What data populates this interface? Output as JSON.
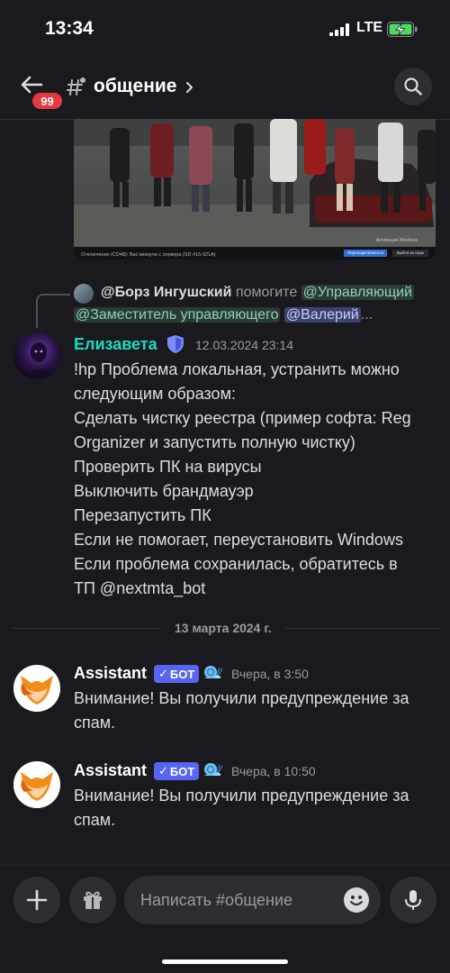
{
  "status": {
    "time": "13:34",
    "network": "LTE"
  },
  "header": {
    "badge": "99",
    "channel": "общение"
  },
  "attachment": {
    "caption": "Отключение (CD48): Вас кикнули с сервера (SD #16-021A)",
    "button_primary": "Переподключиться",
    "button_secondary": "Выйти из игры",
    "sign": "Активация Windows"
  },
  "reply": {
    "author": "@Борз Ингушский",
    "text": "помогите",
    "mention1": "@Управляющий",
    "mention2": "@Заместитель управляющего",
    "mention3": "@Валерий",
    "ellipsis": "..."
  },
  "message1": {
    "author": "Елизавета",
    "timestamp": "12.03.2024 23:14",
    "lines": [
      "!hp Проблема локальная, устранить можно",
      "следующим образом:",
      "Сделать чистку реестра (пример софта: Reg",
      "Organizer и запустить полную чистку)",
      "Проверить ПК на вирусы",
      "Выключить брандмауэр",
      "Перезапустить ПК",
      "Если не помогает, переустановить Windows",
      "Если проблема сохранилась, обратитесь в",
      "ТП @nextmta_bot"
    ]
  },
  "date_divider": "13 марта 2024 г.",
  "message2": {
    "author": "Assistant",
    "bot_tag": "БОТ",
    "timestamp": "Вчера, в 3:50",
    "lines": [
      "Внимание! Вы получили предупреждение за",
      "спам."
    ]
  },
  "message3": {
    "author": "Assistant",
    "bot_tag": "БОТ",
    "timestamp": "Вчера, в 10:50",
    "lines": [
      "Внимание! Вы получили предупреждение за",
      "спам."
    ]
  },
  "composer": {
    "placeholder": "Написать #общение"
  },
  "colors": {
    "accent": "#5865f2",
    "author_elizaveta": "#1ed8c5",
    "badge": "#e23a3f",
    "author_assistant": "#ffffff"
  }
}
